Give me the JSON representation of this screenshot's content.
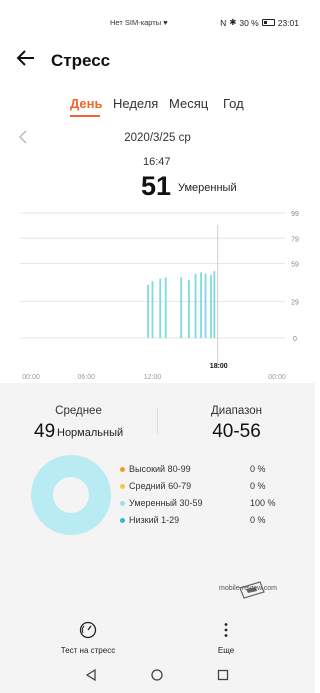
{
  "status": {
    "carrier": "Нет SIM-карты",
    "battery": "30 %",
    "time": "23:01"
  },
  "appbar": {
    "title": "Стресс",
    "back_icon": "arrow-left-icon"
  },
  "tabs": [
    {
      "label": "День",
      "active": true
    },
    {
      "label": "Неделя",
      "active": false
    },
    {
      "label": "Месяц",
      "active": false
    },
    {
      "label": "Год",
      "active": false
    }
  ],
  "date": {
    "label": "2020/3/25  ср",
    "prev_icon": "chevron-left-icon"
  },
  "reading": {
    "time": "16:47",
    "value": "51",
    "label": "Умеренный"
  },
  "chart_data": {
    "type": "bar",
    "x_ticks": [
      "00:00",
      "06:00",
      "12:00",
      "18:00",
      "00:00"
    ],
    "y_ticks": [
      "99",
      "79",
      "59",
      "29",
      "0"
    ],
    "ylim": [
      0,
      99
    ],
    "selected_tick": "18:00",
    "bars": [
      {
        "x": 11.6,
        "y": 42
      },
      {
        "x": 12.0,
        "y": 45
      },
      {
        "x": 12.7,
        "y": 47
      },
      {
        "x": 13.2,
        "y": 48
      },
      {
        "x": 14.6,
        "y": 48
      },
      {
        "x": 15.3,
        "y": 46
      },
      {
        "x": 15.9,
        "y": 51
      },
      {
        "x": 16.4,
        "y": 52
      },
      {
        "x": 16.8,
        "y": 51
      },
      {
        "x": 17.3,
        "y": 50
      },
      {
        "x": 17.6,
        "y": 53
      }
    ],
    "cursor_x": 17.9,
    "bar_color": "#7ed9e3"
  },
  "summary": {
    "avg_title": "Среднее",
    "avg_value": "49",
    "avg_label": "Нормальный",
    "range_title": "Диапазон",
    "range_value": "40-56"
  },
  "legend": [
    {
      "label": "Высокий 80-99",
      "value": "0 %",
      "color": "#f0a020"
    },
    {
      "label": "Средний 60-79",
      "value": "0 %",
      "color": "#f5c64a"
    },
    {
      "label": "Умеренный 30-59",
      "value": "100 %",
      "color": "#9fe0ea"
    },
    {
      "label": "Низкий 1-29",
      "value": "0 %",
      "color": "#3ab6c8"
    }
  ],
  "watermark": "mobile-review.com",
  "actions": {
    "stress_test": "Тест на стресс",
    "more": "Еще"
  },
  "colors": {
    "accent": "#f1662a"
  }
}
